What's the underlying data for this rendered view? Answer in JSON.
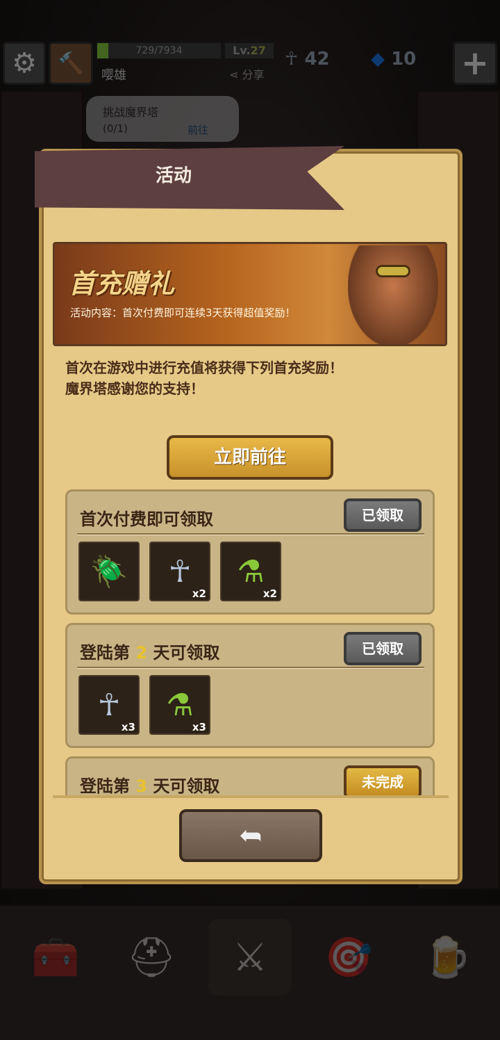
{
  "hud": {
    "xp_text": "729/7934",
    "xp_fraction": 0.092,
    "level_prefix": "Lv.",
    "level": "27",
    "player_name": "嘤雄",
    "share_label": "分享",
    "ankh_count": "42",
    "gem_count": "10"
  },
  "quest": {
    "title": "挑战魔界塔",
    "progress": "(0/1)",
    "go_label": "前往"
  },
  "modal": {
    "title": "活动",
    "banner_title": "首充赠礼",
    "banner_sub": "活动内容：首次付费即可连续3天获得超值奖励！",
    "desc_line1": "首次在游戏中进行充值将获得下列首充奖励！",
    "desc_line2": "魔界塔感谢您的支持！",
    "go_button": "立即前往",
    "rewards": [
      {
        "title": "首次付费即可领取",
        "status": "已领取",
        "items": [
          {
            "icon": "beetle-icon",
            "qty": ""
          },
          {
            "icon": "ankh-icon",
            "qty": "x2"
          },
          {
            "icon": "potion-icon",
            "qty": "x2"
          }
        ]
      },
      {
        "title_pre": "登陆第",
        "day": "2",
        "title_post": "天可领取",
        "status": "已领取",
        "items": [
          {
            "icon": "ankh-icon",
            "qty": "x3"
          },
          {
            "icon": "potion-icon",
            "qty": "x3"
          }
        ]
      },
      {
        "title_pre": "登陆第",
        "day": "3",
        "title_post": "天可领取",
        "status": "未完成"
      }
    ]
  },
  "colors": {
    "parchment": "#e6c987",
    "ribbon": "#5e3f3f",
    "gold_button": "#d8a438",
    "gray_button": "#6a6a6a"
  }
}
